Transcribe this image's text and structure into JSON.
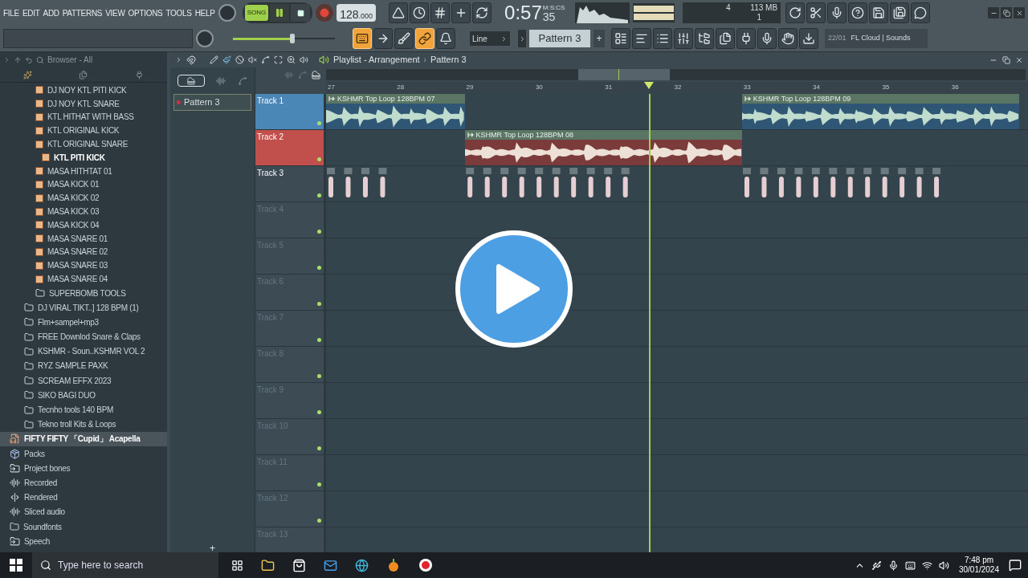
{
  "menu": [
    "FILE",
    "EDIT",
    "ADD",
    "PATTERNS",
    "VIEW",
    "OPTIONS",
    "TOOLS",
    "HELP"
  ],
  "transport": {
    "mode_label": "SONG",
    "song_mode": true,
    "playing": true,
    "recording": false
  },
  "tempo": {
    "main": "128",
    "fraction": ".000"
  },
  "row1_buttons": [
    {
      "kind": "metronome",
      "on": false
    },
    {
      "kind": "wait",
      "on": false
    },
    {
      "kind": "countdown",
      "on": false
    },
    {
      "kind": "step-edit",
      "on": false
    },
    {
      "kind": "loop-record",
      "on": false
    }
  ],
  "time": {
    "main": "0:57",
    "fraction": "35",
    "format": "M:S:CS"
  },
  "cpu": {
    "cpu": "4",
    "memory": "113 MB",
    "polyphony": "1"
  },
  "row1_right_buttons": [
    {
      "kind": "undo"
    },
    {
      "kind": "cut"
    },
    {
      "kind": "mic"
    },
    {
      "kind": "help"
    },
    {
      "kind": "save"
    },
    {
      "kind": "export"
    },
    {
      "kind": "chat"
    }
  ],
  "master_volume": {
    "level": 0.58
  },
  "row2_buttons": [
    {
      "kind": "keyboard",
      "on": true
    },
    {
      "kind": "arrow",
      "on": false
    },
    {
      "kind": "brush",
      "on": false
    },
    {
      "kind": "link",
      "on": true
    },
    {
      "kind": "bell",
      "on": false
    }
  ],
  "snap": {
    "value": "Line"
  },
  "pattern_selector": {
    "value": "Pattern 3",
    "add": "+"
  },
  "row2_right_buttons": [
    {
      "kind": "playlist"
    },
    {
      "kind": "piano-roll"
    },
    {
      "kind": "channel-rack"
    },
    {
      "kind": "mixer"
    },
    {
      "kind": "browser"
    },
    {
      "kind": "files"
    },
    {
      "kind": "plugin"
    },
    {
      "kind": "mic-stand"
    },
    {
      "kind": "hand"
    },
    {
      "kind": "download"
    }
  ],
  "cloud": {
    "date": "22/01",
    "label": "FL Cloud | Sounds"
  },
  "browser": {
    "title": "Browser - All",
    "tree": [
      {
        "children": [
          {
            "children": [
              {
                "kind": "sample",
                "label": "DJ NOY KTL PITI KICK",
                "selected": false
              },
              {
                "kind": "sample",
                "label": "DJ NOY KTL SNARE",
                "selected": false
              },
              {
                "kind": "sample",
                "label": "KTL HITHAT WITH BASS",
                "selected": false
              },
              {
                "kind": "sample",
                "label": "KTL ORIGINAL KICK",
                "selected": false
              },
              {
                "kind": "sample",
                "label": "KTL ORIGINAL SNARE",
                "selected": false
              },
              {
                "kind": "sample",
                "label": "KTL PITI KICK",
                "selected": true
              },
              {
                "kind": "sample",
                "label": "MASA HITHTAT 01",
                "selected": false
              },
              {
                "kind": "sample",
                "label": "MASA KICK 01",
                "selected": false
              },
              {
                "kind": "sample",
                "label": "MASA KICK 02",
                "selected": false
              },
              {
                "kind": "sample",
                "label": "MASA KICK 03",
                "selected": false
              },
              {
                "kind": "sample",
                "label": "MASA KICK 04",
                "selected": false
              },
              {
                "kind": "sample",
                "label": "MASA SNARE 01",
                "selected": false
              },
              {
                "kind": "sample",
                "label": "MASA SNARE 02",
                "selected": false
              },
              {
                "kind": "sample",
                "label": "MASA SNARE 03",
                "selected": false
              },
              {
                "kind": "sample",
                "label": "MASA SNARE 04",
                "selected": false
              },
              {
                "kind": "folder",
                "label": "SUPERBOMB TOOLS",
                "selected": false
              }
            ]
          },
          {
            "kind": "folder",
            "label": "DJ VIRAL TIKT..] 128 BPM (1)",
            "selected": false
          },
          {
            "kind": "folder",
            "label": "Flm+sampel+mp3",
            "selected": false
          },
          {
            "kind": "folder",
            "label": "FREE Downlod Snare & Claps",
            "selected": false
          },
          {
            "kind": "folder",
            "label": "KSHMR - Soun..KSHMR VOL 2",
            "selected": false
          },
          {
            "kind": "folder",
            "label": "RYZ SAMPLE PAXK",
            "selected": false
          },
          {
            "kind": "folder",
            "label": "SCREAM EFFX 2023",
            "selected": false
          },
          {
            "kind": "folder",
            "label": "SIKO BAGI DUO",
            "selected": false
          },
          {
            "kind": "folder",
            "label": "Tecnho tools 140 BPM",
            "selected": false
          },
          {
            "kind": "folder",
            "label": "Tekno troll  Kits & Loops",
            "selected": false
          }
        ]
      },
      {
        "kind": "mp3",
        "label": "FIFTY FIFTY 「Cupid」 Acapella",
        "selected": true
      },
      {
        "kind": "packs",
        "label": "Packs",
        "selected": false
      },
      {
        "kind": "project",
        "label": "Project bones",
        "selected": false
      },
      {
        "kind": "audio",
        "label": "Recorded",
        "selected": false
      },
      {
        "kind": "rendered",
        "label": "Rendered",
        "selected": false
      },
      {
        "kind": "audio",
        "label": "Sliced audio",
        "selected": false
      },
      {
        "kind": "folder",
        "label": "Soundfonts",
        "selected": false
      },
      {
        "kind": "project",
        "label": "Speech",
        "selected": false
      }
    ]
  },
  "playlist": {
    "title": "Playlist - Arrangement",
    "separator": "›",
    "pattern": "Pattern 3",
    "patterns": [
      {
        "label": "Pattern 3",
        "selected": true
      }
    ],
    "add": "+",
    "ruler": [
      "27",
      "28",
      "29",
      "30",
      "31",
      "32",
      "33",
      "34",
      "35",
      "36"
    ],
    "playhead": {
      "level": 0.46
    },
    "tracks": [
      {
        "name": "Track 1",
        "color": "#4a86b6",
        "empty": false,
        "clips": [
          {
            "kind": "audio",
            "label": "KSHMR Top Loop 128BPM 07"
          },
          {
            "kind": "audio",
            "label": "KSHMR Top Loop 128BPM 09"
          }
        ]
      },
      {
        "name": "Track 2",
        "color": "#c14f4b",
        "empty": false,
        "clips": [
          {
            "kind": "audio",
            "label": "KSHMR Top Loop 128BPM 08"
          }
        ]
      },
      {
        "name": "Track 3",
        "color": "#3d4b54",
        "empty": false,
        "clips": [
          {
            "kind": "pattern"
          },
          {
            "kind": "pattern"
          },
          {
            "kind": "pattern"
          }
        ]
      },
      {
        "name": "Track 4",
        "color": "#3d4b54",
        "empty": true
      },
      {
        "name": "Track 5",
        "color": "#3d4b54",
        "empty": true
      },
      {
        "name": "Track 6",
        "color": "#3d4b54",
        "empty": true
      },
      {
        "name": "Track 7",
        "color": "#3d4b54",
        "empty": true
      },
      {
        "name": "Track 8",
        "color": "#3d4b54",
        "empty": true
      },
      {
        "name": "Track 9",
        "color": "#3d4b54",
        "empty": true
      },
      {
        "name": "Track 10",
        "color": "#3d4b54",
        "empty": true
      },
      {
        "name": "Track 11",
        "color": "#3d4b54",
        "empty": true
      },
      {
        "name": "Track 12",
        "color": "#3d4b54",
        "empty": true
      },
      {
        "name": "Track 13",
        "color": "#3d4b54",
        "empty": true
      }
    ]
  },
  "taskbar": {
    "search_placeholder": "Type here to search",
    "time": "7:48 pm",
    "date": "30/01/2024"
  }
}
